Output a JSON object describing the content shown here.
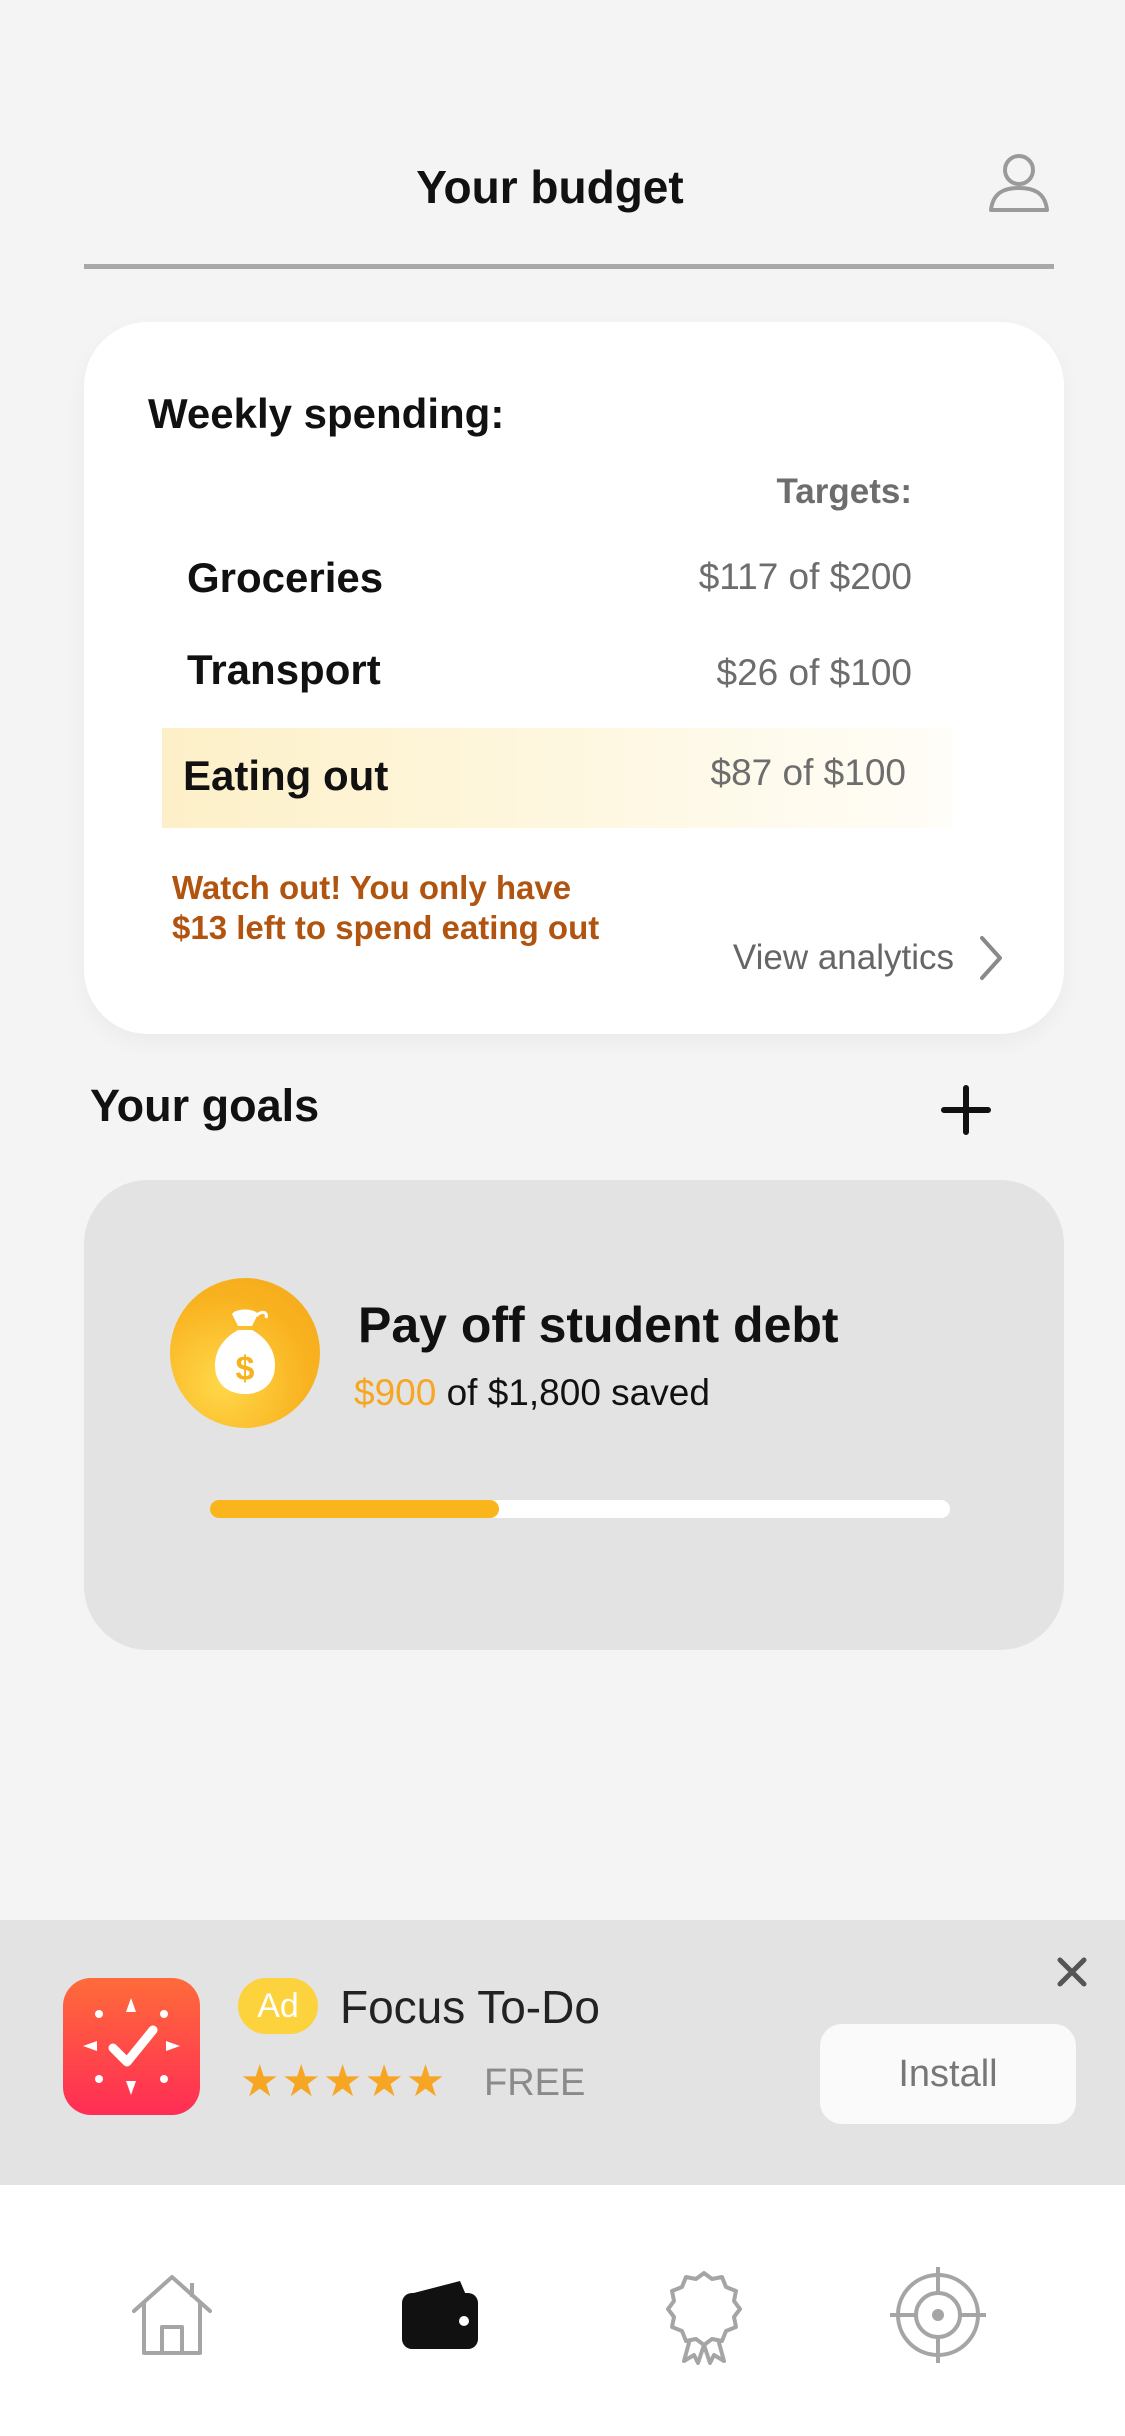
{
  "header": {
    "title": "Your budget"
  },
  "budget": {
    "heading": "Weekly spending:",
    "targets_label": "Targets:",
    "rows": [
      {
        "name": "Groceries",
        "value": "$117 of $200"
      },
      {
        "name": "Transport",
        "value": "$26 of $100"
      },
      {
        "name": "Eating out",
        "value": "$87 of $100"
      }
    ],
    "warning_line1": "Watch out! You only have",
    "warning_line2": "$13 left to spend eating out",
    "analytics_link": "View analytics"
  },
  "goals": {
    "heading": "Your goals",
    "items": [
      {
        "title": "Pay off student debt",
        "saved": "$900",
        "rest": " of $1,800 saved",
        "progress": 0.5,
        "icon": "money-bag-icon"
      }
    ]
  },
  "ad": {
    "tag": "Ad",
    "title": "Focus To-Do",
    "stars": "★★★★★",
    "rating": 4.5,
    "price": "FREE",
    "install": "Install"
  },
  "nav": {
    "items": [
      {
        "icon": "home-icon",
        "active": false
      },
      {
        "icon": "wallet-icon",
        "active": true
      },
      {
        "icon": "award-icon",
        "active": false
      },
      {
        "icon": "target-icon",
        "active": false
      }
    ]
  },
  "colors": {
    "accent": "#f6a623",
    "warning": "#b05410",
    "progress": "#fbb51c"
  }
}
